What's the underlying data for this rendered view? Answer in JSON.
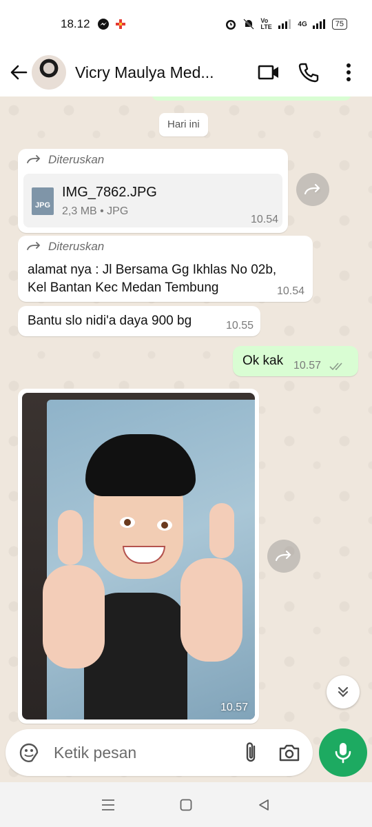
{
  "status_bar": {
    "time": "18.12",
    "network_label": "Vo LTE",
    "signal_label": "4G",
    "battery": "75"
  },
  "header": {
    "contact_name": "Vicry Maulya Med..."
  },
  "chat": {
    "date_chip": "Hari ini",
    "messages": [
      {
        "forwarded_label": "Diteruskan",
        "file_name": "IMG_7862.JPG",
        "file_meta": "2,3 MB • JPG",
        "file_type": "JPG",
        "time": "10.54"
      },
      {
        "forwarded_label": "Diteruskan",
        "text_line1": "alamat nya : Jl Bersama Gg Ikhlas No 02b,",
        "text_line2": "Kel Bantan Kec Medan Tembung",
        "time": "10.54"
      },
      {
        "text": "Bantu slo nidi'a daya 900 bg",
        "time": "10.55"
      },
      {
        "text": "Ok kak",
        "time": "10.57",
        "read_icon": "double-check-icon"
      },
      {
        "image": "id-card-photo-with-sticker",
        "time": "10.57"
      }
    ]
  },
  "composer": {
    "placeholder": "Ketik pesan"
  },
  "colors": {
    "accent_green": "#1daa61",
    "outgoing_bubble": "#d9fdd3",
    "chat_bg": "#efe7dd",
    "read_tick": "#53bdeb"
  }
}
